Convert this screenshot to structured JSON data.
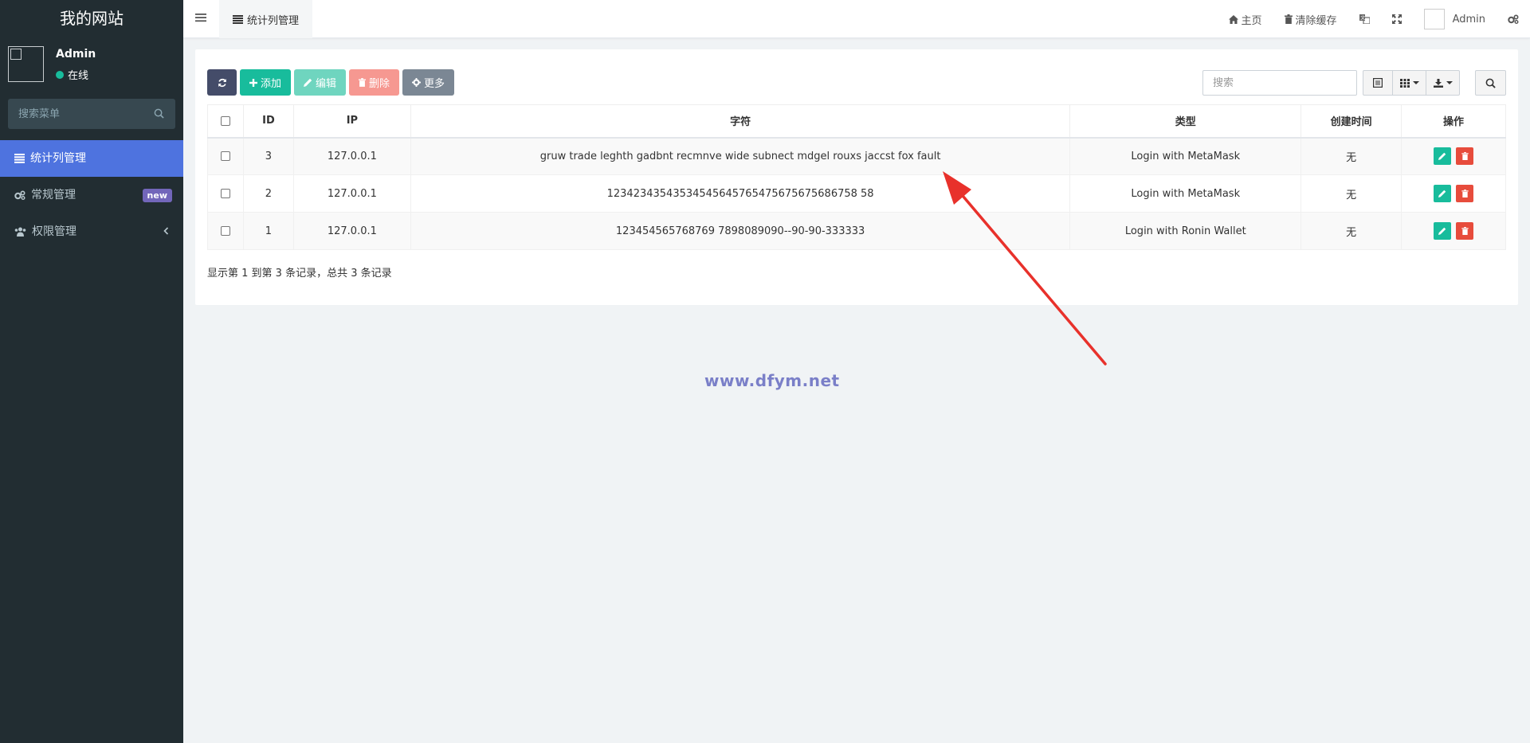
{
  "sidebar": {
    "brand": "我的网站",
    "user": {
      "name": "Admin",
      "status": "在线"
    },
    "search_placeholder": "搜索菜单",
    "items": [
      {
        "label": "统计列管理",
        "icon": "list-icon",
        "active": true
      },
      {
        "label": "常规管理",
        "icon": "gears-icon",
        "badge": "new"
      },
      {
        "label": "权限管理",
        "icon": "users-icon"
      }
    ]
  },
  "header": {
    "tab_label": "统计列管理",
    "home_label": "主页",
    "clear_cache_label": "清除缓存",
    "user_name": "Admin"
  },
  "toolbar": {
    "add_label": "添加",
    "edit_label": "编辑",
    "delete_label": "删除",
    "more_label": "更多",
    "search_placeholder": "搜索"
  },
  "table": {
    "columns": [
      "ID",
      "IP",
      "字符",
      "类型",
      "创建时间",
      "操作"
    ],
    "rows": [
      {
        "id": "3",
        "ip": "127.0.0.1",
        "chars": "gruw trade leghth gadbnt recmnve wide subnect mdgel rouxs jaccst fox fault",
        "type": "Login with MetaMask",
        "created": "无"
      },
      {
        "id": "2",
        "ip": "127.0.0.1",
        "chars": "12342343543534545645765475675675686758 58",
        "type": "Login with MetaMask",
        "created": "无"
      },
      {
        "id": "1",
        "ip": "127.0.0.1",
        "chars": "123454565768769 7898089090--90-90-333333",
        "type": "Login with Ronin Wallet",
        "created": "无"
      }
    ]
  },
  "pagination_text": "显示第 1 到第 3 条记录，总共 3 条记录",
  "watermark": "www.dfym.net",
  "colors": {
    "sidebar_bg": "#222d32",
    "active_item": "#4e73df",
    "success": "#18bc9c",
    "danger": "#e74c3c",
    "badge": "#7266ba",
    "annotation_arrow": "#e8312b"
  }
}
